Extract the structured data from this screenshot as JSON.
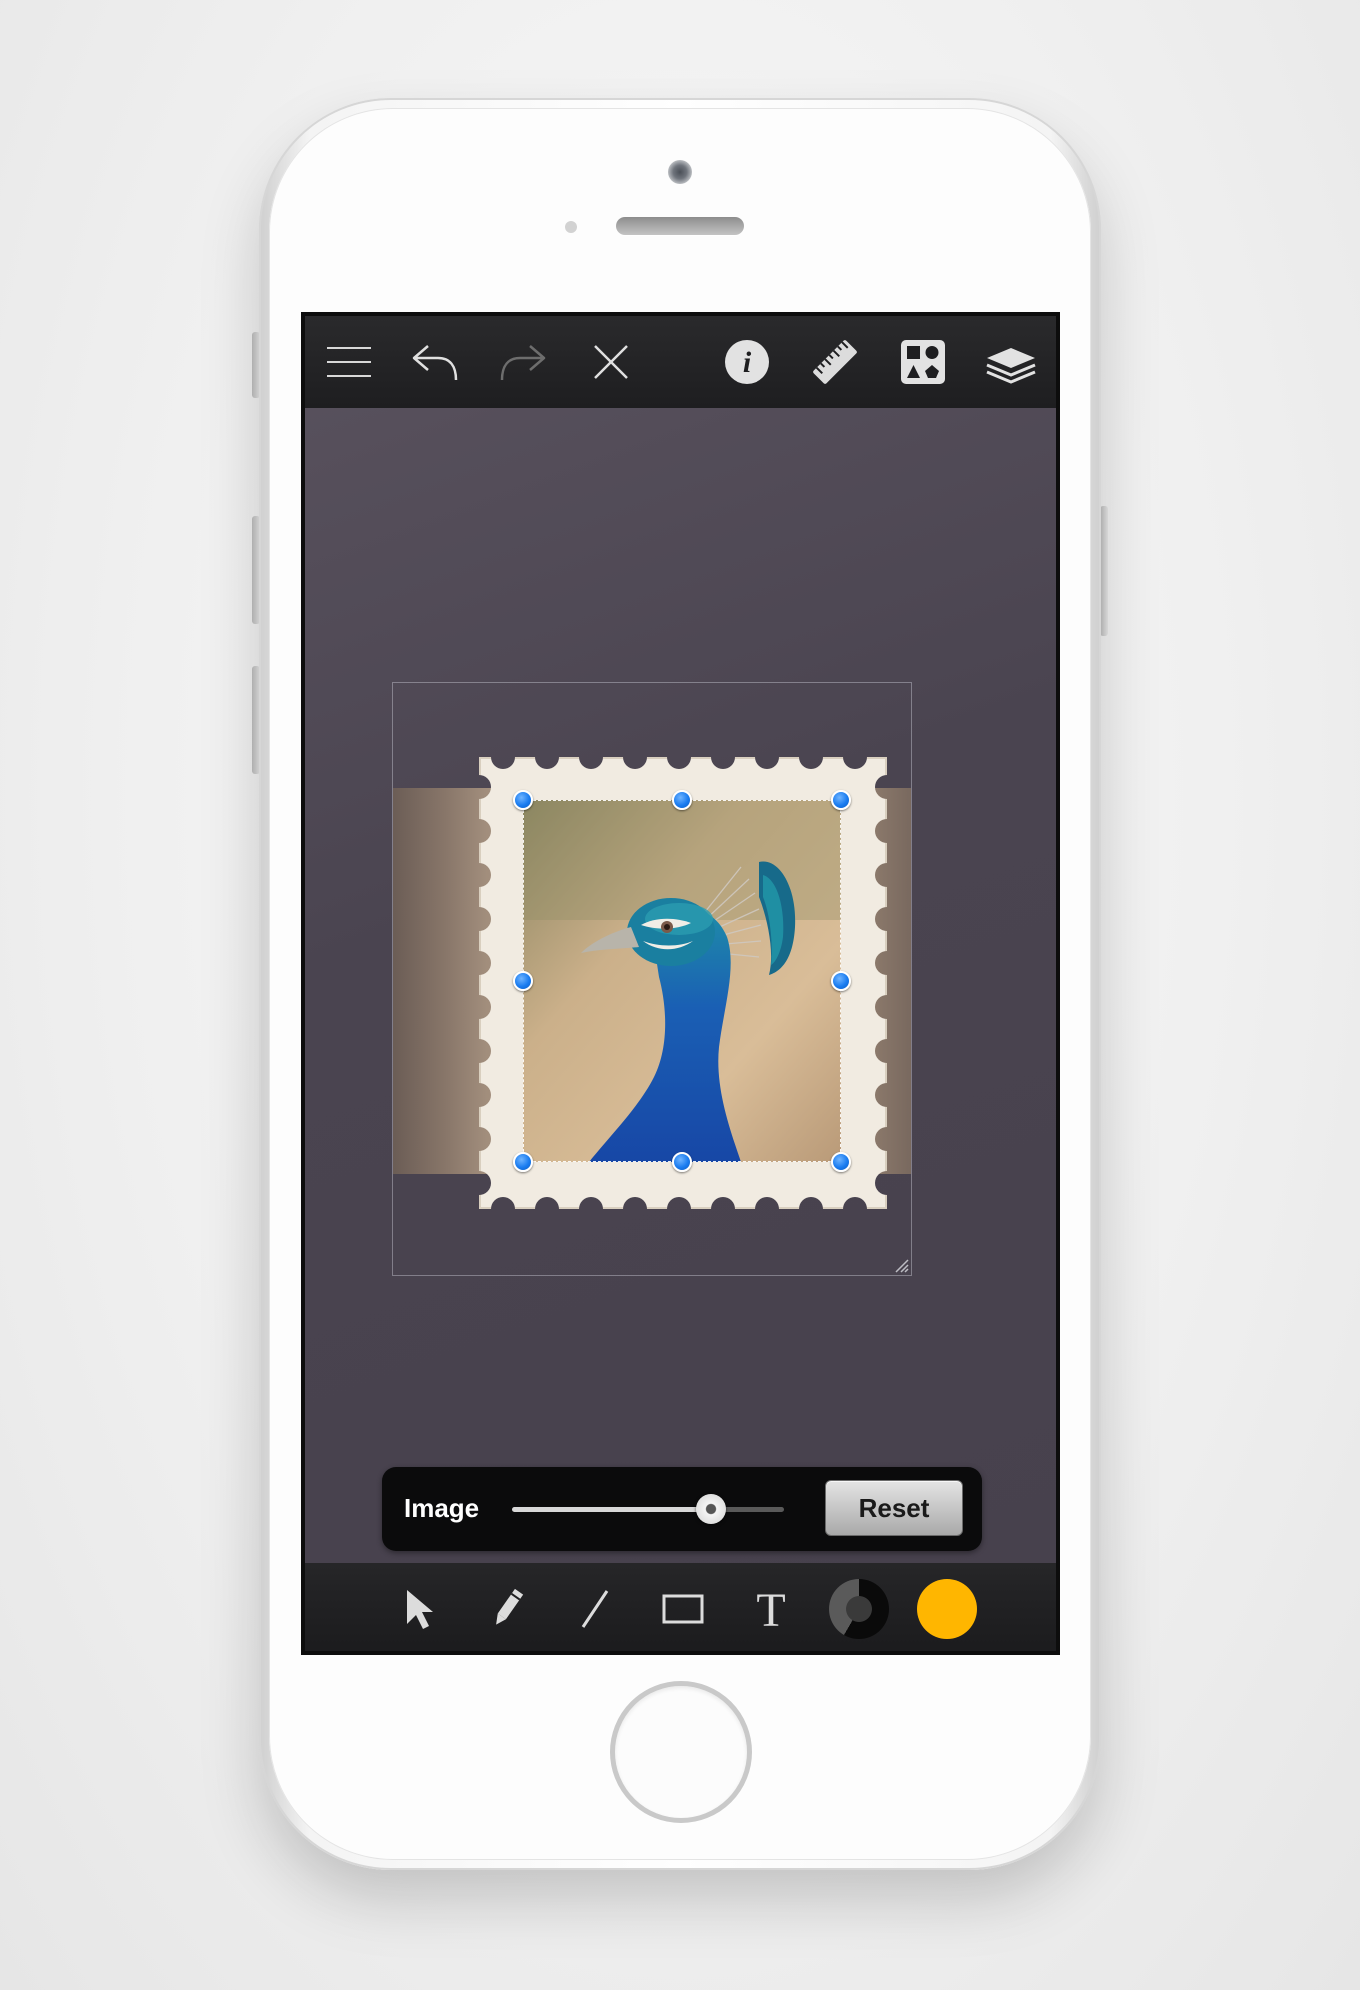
{
  "toolbar": {
    "top_icons": [
      "menu-icon",
      "undo-icon",
      "redo-icon",
      "close-icon",
      "info-icon",
      "ruler-icon",
      "shapes-icon",
      "layers-icon"
    ],
    "bottom_icons": [
      "select-arrow-icon",
      "pencil-icon",
      "line-icon",
      "rectangle-icon",
      "text-icon"
    ]
  },
  "adjust_panel": {
    "label": "Image",
    "slider_value_fraction": 0.73,
    "reset_label": "Reset"
  },
  "colors": {
    "stroke_swatch": "#1a1a1a",
    "fill_swatch": "#ffb600",
    "canvas_bg": "#4a4450",
    "selection_handle": "#1a7cf0"
  },
  "canvas": {
    "content": "postage-stamp-photo",
    "selection_active": true
  }
}
